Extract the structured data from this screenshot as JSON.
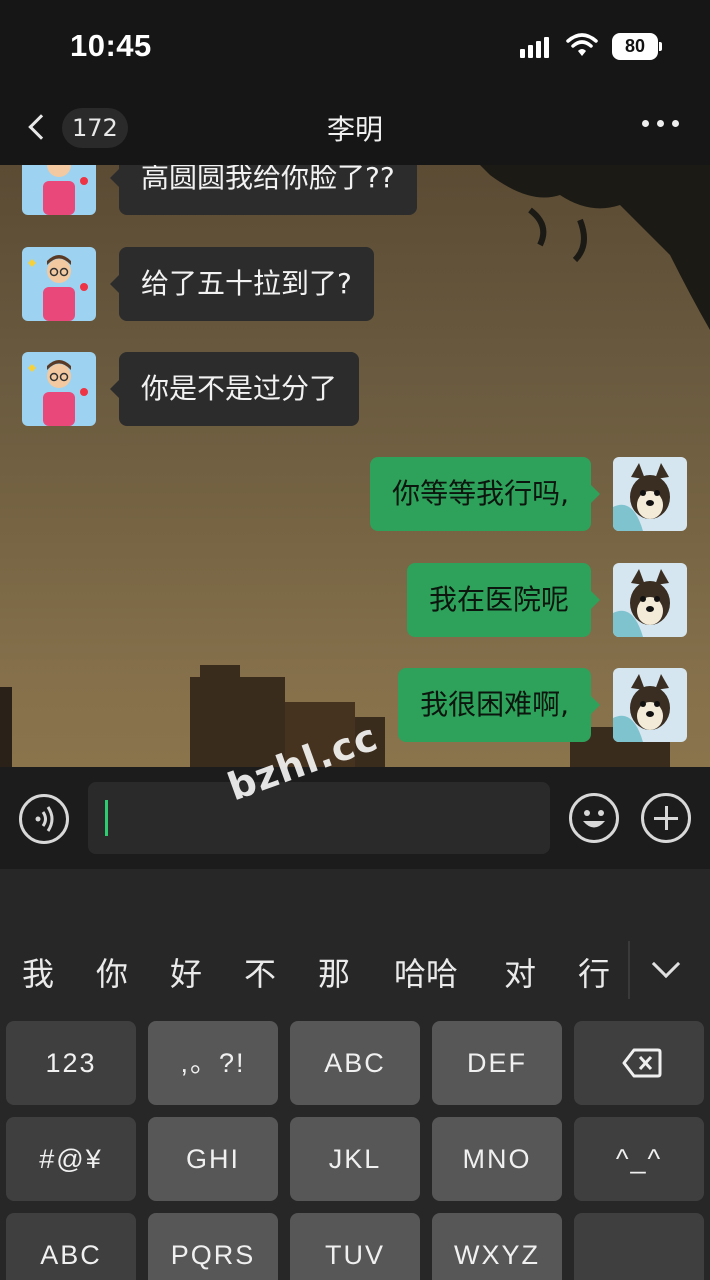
{
  "status_bar": {
    "time": "10:45",
    "battery": "80"
  },
  "nav": {
    "back_count": "172",
    "title": "李明"
  },
  "messages": [
    {
      "side": "in",
      "text": "高圆圆我给你脸了??"
    },
    {
      "side": "in",
      "text": "给了五十拉到了?"
    },
    {
      "side": "in",
      "text": "你是不是过分了"
    },
    {
      "side": "out",
      "text": "你等等我行吗,"
    },
    {
      "side": "out",
      "text": "我在医院呢"
    },
    {
      "side": "out",
      "text": "我很困难啊,"
    }
  ],
  "input": {
    "value": ""
  },
  "candidates": [
    "我",
    "你",
    "好",
    "不",
    "那",
    "哈哈",
    "对",
    "行"
  ],
  "keyboard": {
    "row1": [
      "123",
      ",。?!",
      "ABC",
      "DEF"
    ],
    "row2": [
      "#@¥",
      "GHI",
      "JKL",
      "MNO",
      "^_^"
    ],
    "row3": [
      "ABC",
      "PQRS",
      "TUV",
      "WXYZ",
      ""
    ]
  },
  "watermark": "bzhl.cc",
  "colors": {
    "outgoing_bubble": "#2ea15a",
    "incoming_bubble": "#2c2c2c",
    "caret": "#2ecc71"
  }
}
